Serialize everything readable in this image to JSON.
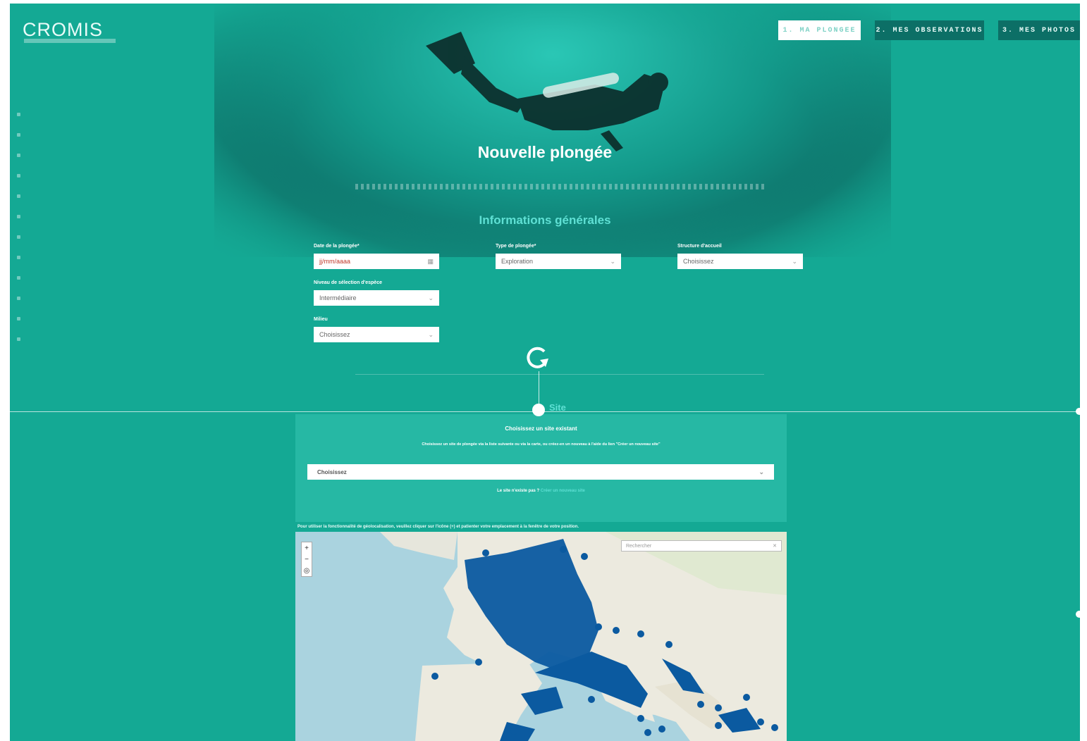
{
  "brand": {
    "name": "CROMIS"
  },
  "nav": {
    "item1": "1. MA PLONGEE",
    "item2": "2. MES OBSERVATIONS",
    "item3": "3. MES PHOTOS"
  },
  "page": {
    "title": "Nouvelle plongée",
    "section_title": "Informations générales"
  },
  "form": {
    "date": {
      "label": "Date de la plongée*",
      "placeholder": "jj/mm/aaaa"
    },
    "type": {
      "label": "Type de plongée*",
      "value": "Exploration"
    },
    "structure": {
      "label": "Structure d'accueil",
      "value": "Choisissez"
    },
    "niveau": {
      "label": "Niveau de sélection d'espèce",
      "value": "Intermédiaire"
    },
    "milieu": {
      "label": "Milieu",
      "value": "Choisissez"
    }
  },
  "site": {
    "step_label": "Site",
    "panel_title": "Choisissez un site existant",
    "panel_desc": "Choisissez un site de plongée via la liste suivante ou via la carte, ou créez-en un nouveau à l'aide du lien \"Créer un nouveau site\"",
    "select_value": "Choisissez",
    "question": "Le site n'existe pas ?",
    "create_link": "Créer un nouveau site",
    "map_hint": "Pour utiliser la fonctionnalité de géolocalisation, veuillez cliquer sur l'icône (+) et patienter votre emplacement à la fenêtre de votre position.",
    "search_placeholder": "Rechercher"
  },
  "colors": {
    "background": "#14a994",
    "accent": "#5fe0d4",
    "nav_dark": "#0c6f66",
    "marker": "#0b5aa0"
  }
}
